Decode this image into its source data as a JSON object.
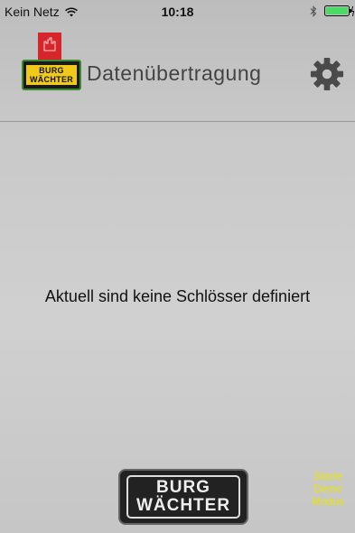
{
  "status_bar": {
    "carrier": "Kein Netz",
    "time": "10:18"
  },
  "header": {
    "logo_line1": "BURG",
    "logo_line2": "WÄCHTER",
    "title": "Datenübertragung",
    "settings_icon": "gear-icon"
  },
  "main": {
    "empty_message": "Aktuell sind keine Schlösser definiert"
  },
  "footer": {
    "logo_line1": "BURG",
    "logo_line2": "WÄCHTER",
    "demo_line1": "Starte",
    "demo_line2": "Demo",
    "demo_line3": "Modus"
  },
  "colors": {
    "demo_text": "#e7e600",
    "logo_yellow": "#f0c91a",
    "logo_red": "#d6262b",
    "logo_green": "#3b8a2f"
  }
}
